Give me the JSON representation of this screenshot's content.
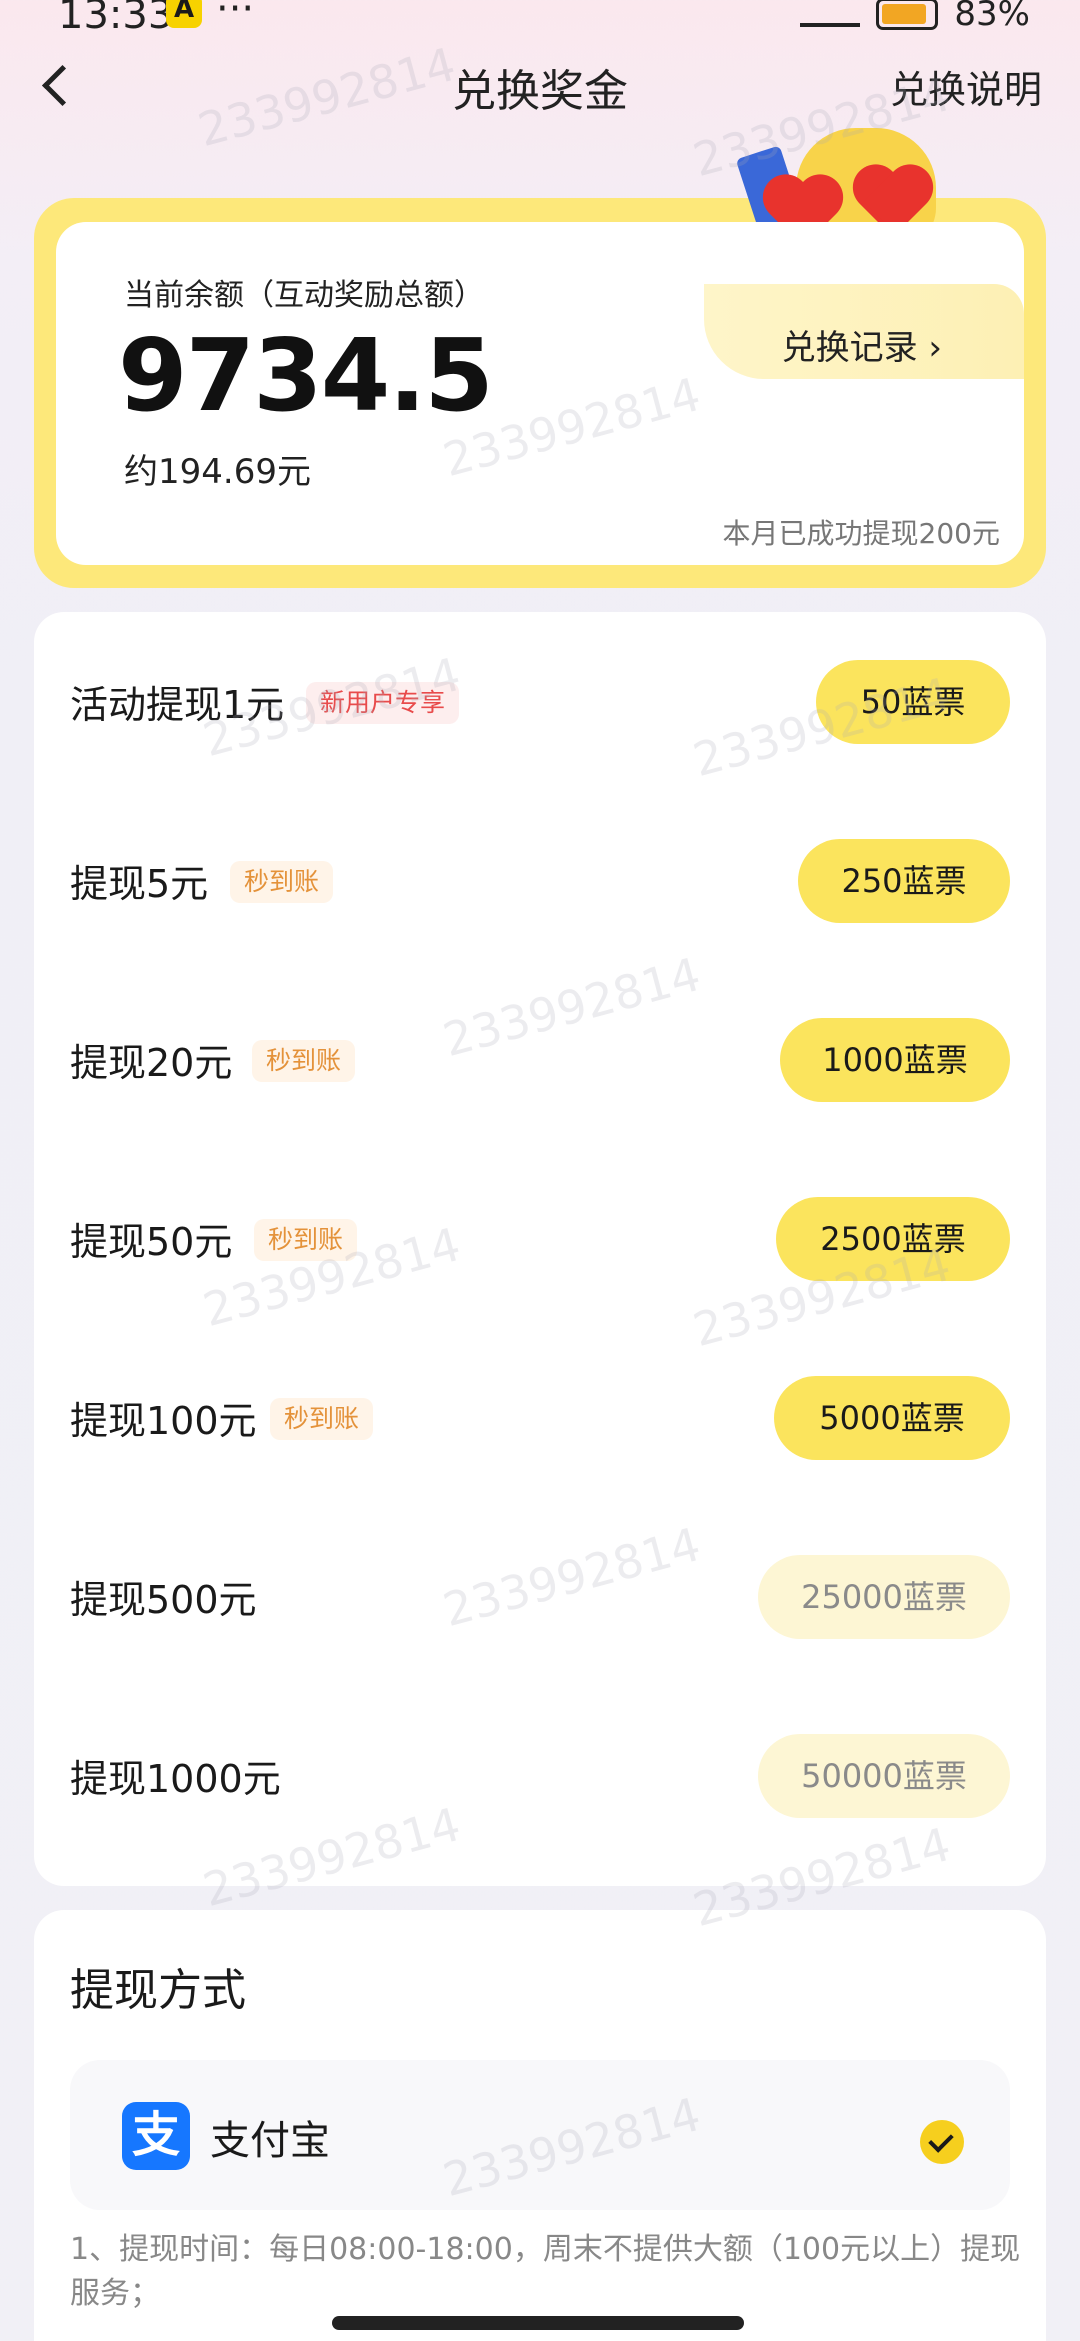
{
  "status_bar": {
    "time": "13:33",
    "app_badge": "A",
    "dots": "···",
    "battery": "83%"
  },
  "header": {
    "title": "兑换奖金",
    "help_label": "兑换说明"
  },
  "balance": {
    "label": "当前余额（互动奖励总额）",
    "value": "9734.5",
    "approx": "约194.69元",
    "record_link": "兑换记录 ›",
    "month_note": "本月已成功提现200元"
  },
  "withdraw_options": [
    {
      "title": "活动提现1元",
      "badge": "新用户专享",
      "badge_type": "red",
      "price": "50蓝票",
      "enabled": true
    },
    {
      "title": "提现5元",
      "badge": "秒到账",
      "badge_type": "orange",
      "price": "250蓝票",
      "enabled": true
    },
    {
      "title": "提现20元",
      "badge": "秒到账",
      "badge_type": "orange",
      "price": "1000蓝票",
      "enabled": true
    },
    {
      "title": "提现50元",
      "badge": "秒到账",
      "badge_type": "orange",
      "price": "2500蓝票",
      "enabled": true
    },
    {
      "title": "提现100元",
      "badge": "秒到账",
      "badge_type": "orange",
      "price": "5000蓝票",
      "enabled": true
    },
    {
      "title": "提现500元",
      "badge": "",
      "badge_type": "",
      "price": "25000蓝票",
      "enabled": false
    },
    {
      "title": "提现1000元",
      "badge": "",
      "badge_type": "",
      "price": "50000蓝票",
      "enabled": false
    }
  ],
  "method": {
    "title": "提现方式",
    "option_label": "支付宝",
    "option_icon": "支",
    "note": "1、提现时间：每日08:00-18:00，周末不提供大额（100元以上）提现服务；"
  },
  "watermark_text": "233992814",
  "colors": {
    "accent_yellow": "#fbe45d",
    "card_border": "#fde87a",
    "badge_red": "#e84b4b",
    "badge_orange": "#e4923a"
  }
}
